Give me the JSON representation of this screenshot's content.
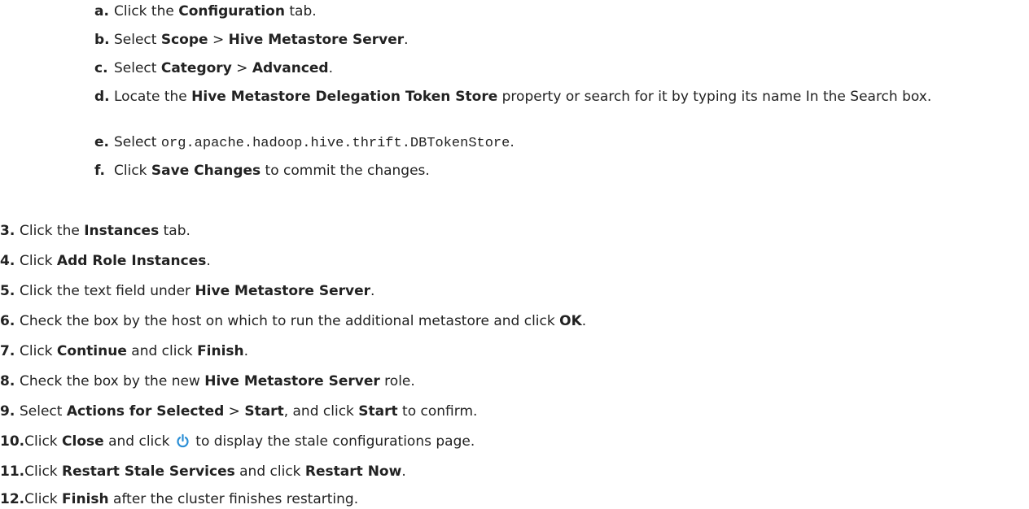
{
  "colors": {
    "text": "#222222",
    "background": "#ffffff",
    "power_icon": "#2b8fd6"
  },
  "icons": {
    "step10": "power-icon"
  },
  "substeps": [
    {
      "marker": "a.",
      "parts": [
        "Click the ",
        "Configuration",
        " tab."
      ]
    },
    {
      "marker": "b.",
      "parts": [
        "Select ",
        "Scope",
        " > ",
        "Hive Metastore Server",
        "."
      ]
    },
    {
      "marker": "c.",
      "parts": [
        "Select ",
        "Category",
        " > ",
        "Advanced",
        "."
      ]
    },
    {
      "marker": "d.",
      "parts": [
        "Locate the ",
        "Hive Metastore Delegation Token Store",
        " property or search for it by typing its name In the Search box."
      ]
    },
    {
      "marker": "e.",
      "parts": [
        "Select ",
        "org.apache.hadoop.hive.thrift.DBTokenStore",
        "."
      ]
    },
    {
      "marker": "f.",
      "parts": [
        "Click ",
        "Save Changes",
        " to commit the changes."
      ]
    }
  ],
  "steps": [
    {
      "marker": "3.",
      "parts": [
        "Click the ",
        "Instances",
        " tab."
      ]
    },
    {
      "marker": "4.",
      "parts": [
        "Click ",
        "Add Role Instances",
        "."
      ]
    },
    {
      "marker": "5.",
      "parts": [
        "Click the text field under ",
        "Hive Metastore Server",
        "."
      ]
    },
    {
      "marker": "6.",
      "parts": [
        "Check the box by the host on which to run the additional metastore and click ",
        "OK",
        "."
      ]
    },
    {
      "marker": "7.",
      "parts": [
        "Click ",
        "Continue",
        " and click ",
        "Finish",
        "."
      ]
    },
    {
      "marker": "8.",
      "parts": [
        "Check the box by the new ",
        "Hive Metastore Server",
        " role."
      ]
    },
    {
      "marker": "9.",
      "parts": [
        "Select ",
        "Actions for Selected",
        " > ",
        "Start",
        ", and click ",
        "Start",
        " to confirm."
      ]
    },
    {
      "marker": "10.",
      "parts": [
        "Click ",
        "Close",
        " and click ",
        " to display the stale configurations page."
      ]
    },
    {
      "marker": "11.",
      "parts": [
        "Click ",
        "Restart Stale Services",
        " and click ",
        "Restart Now",
        "."
      ]
    },
    {
      "marker": "12.",
      "parts": [
        "Click ",
        "Finish",
        " after the cluster finishes restarting."
      ]
    }
  ]
}
